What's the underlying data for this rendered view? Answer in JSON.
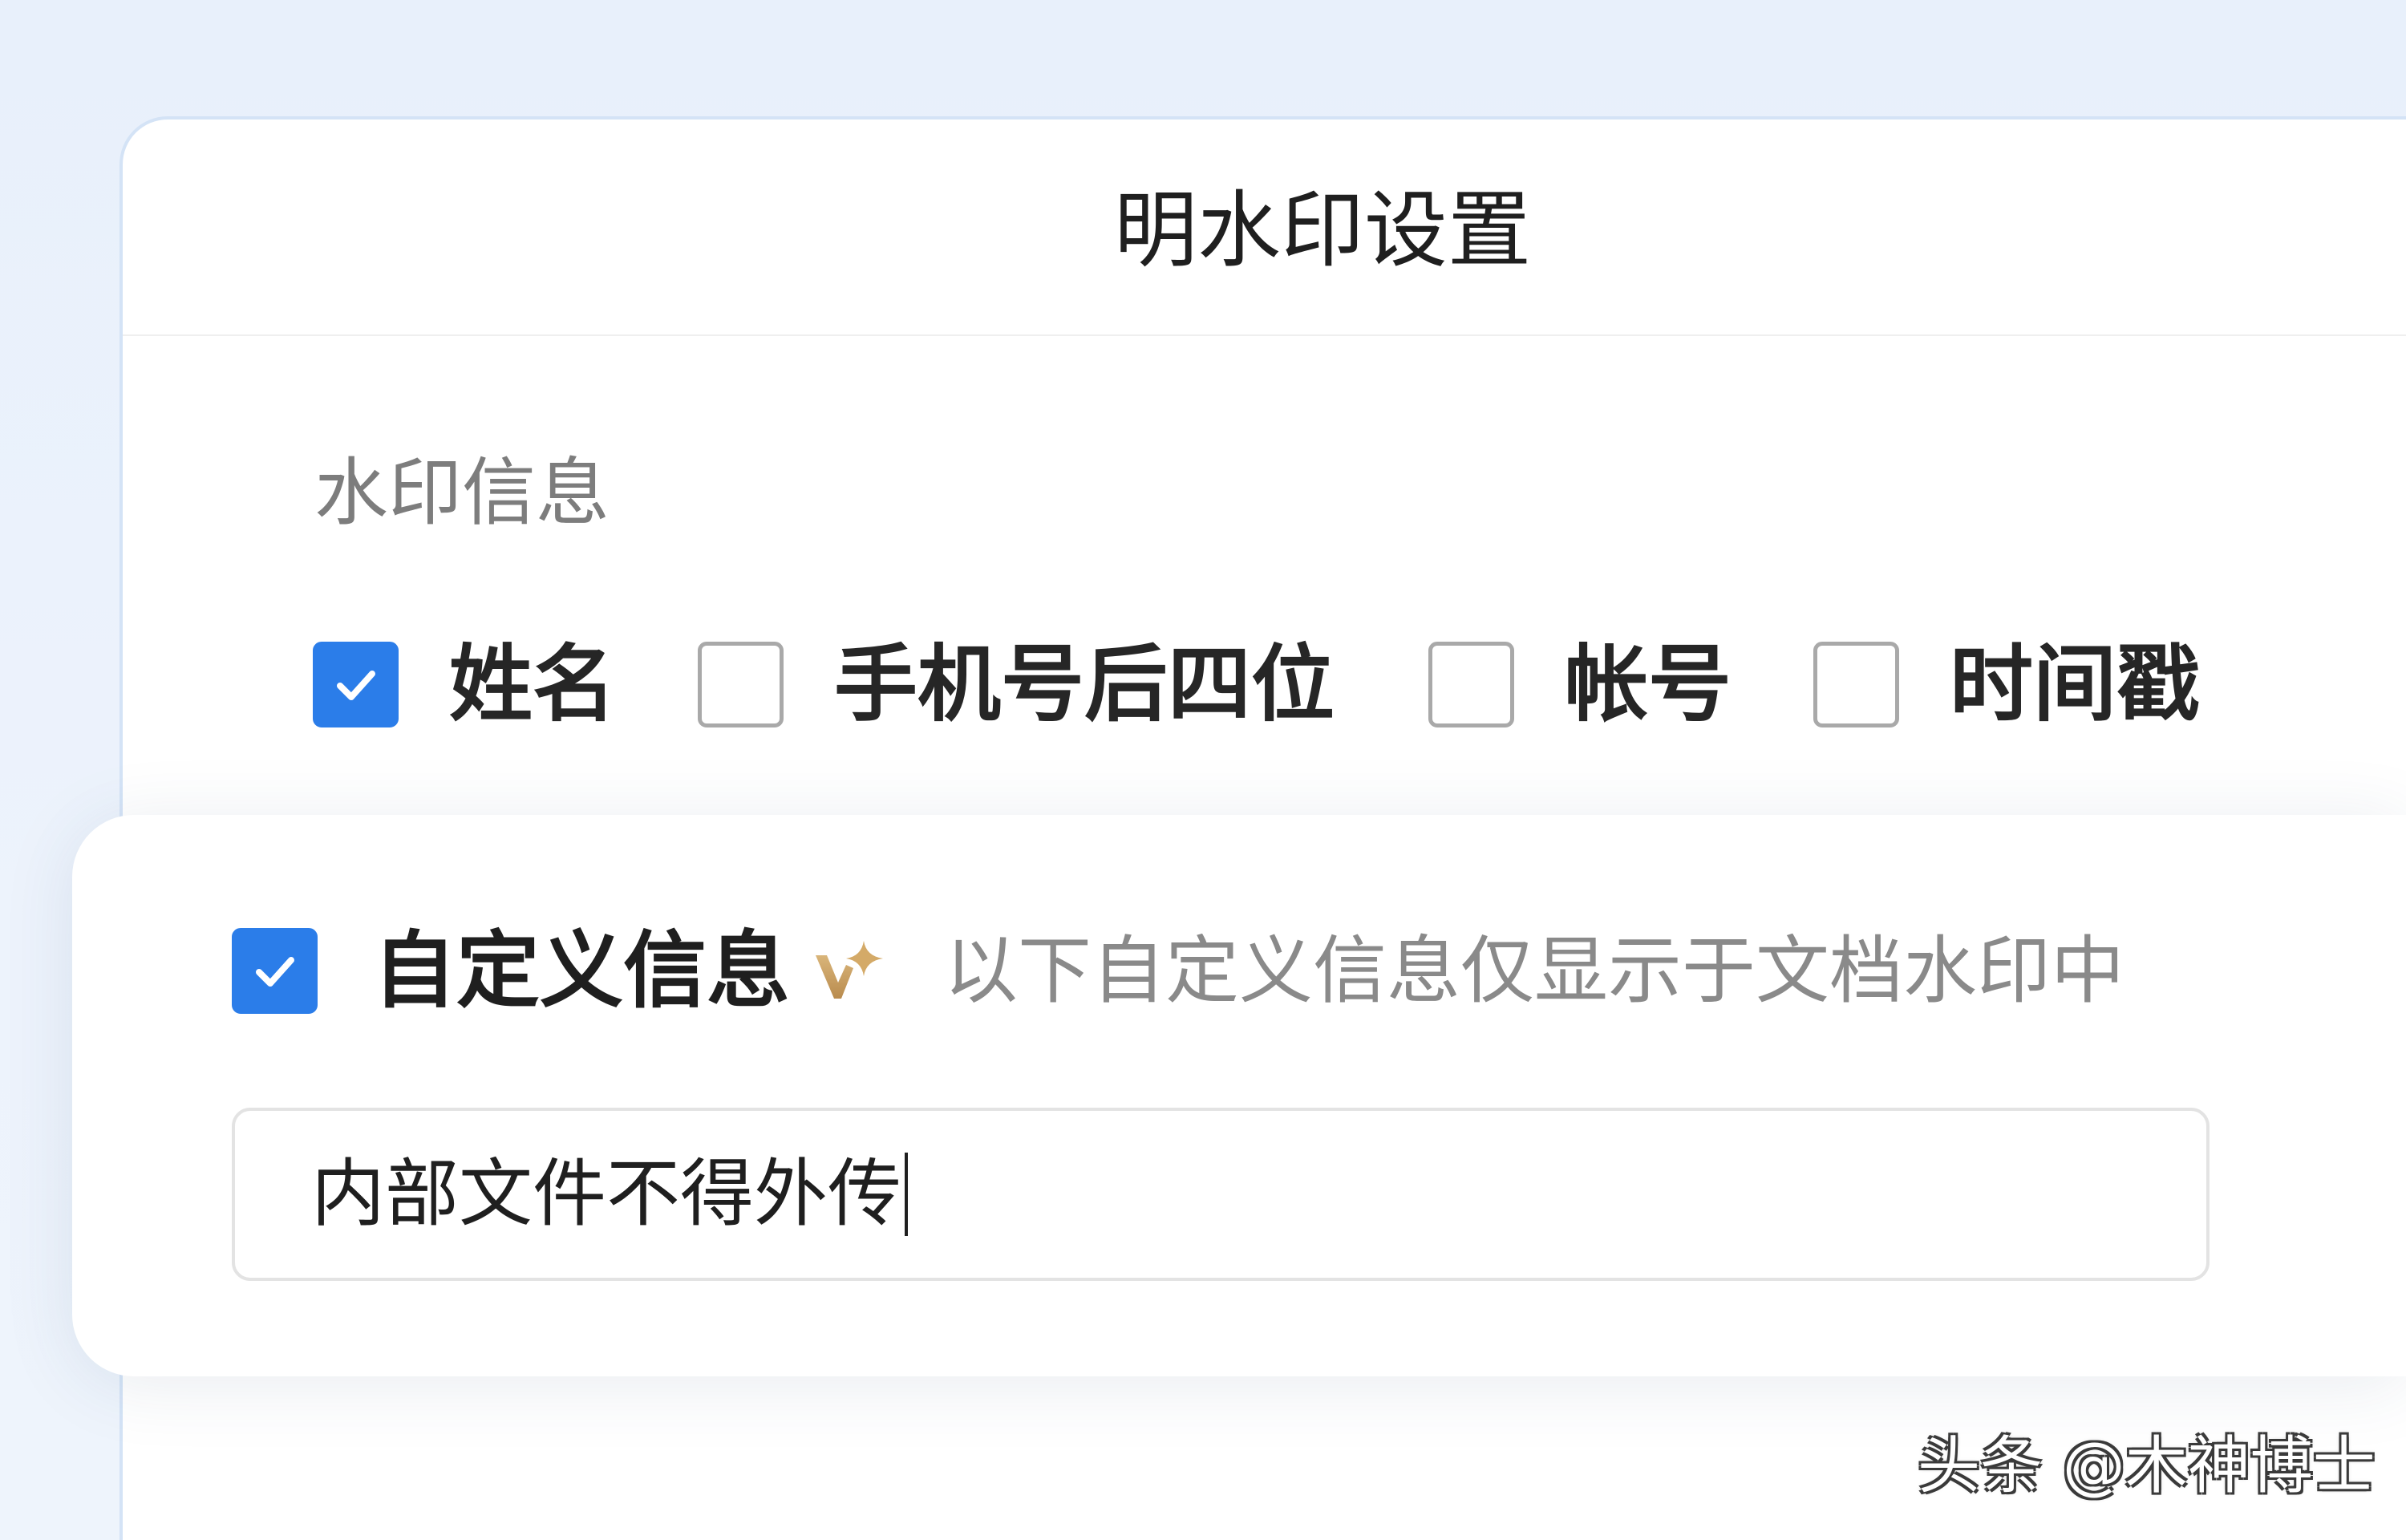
{
  "panel": {
    "title": "明水印设置"
  },
  "watermark_info": {
    "label": "水印信息",
    "options": [
      {
        "label": "姓名",
        "checked": true
      },
      {
        "label": "手机号后四位",
        "checked": false
      },
      {
        "label": "帐号",
        "checked": false
      },
      {
        "label": "时间戳",
        "checked": false
      }
    ]
  },
  "custom_info": {
    "label": "自定义信息",
    "checked": true,
    "badge_icon": "vip-sparkle-icon",
    "hint": "以下自定义信息仅显示于文档水印中",
    "input_value": "内部文件不得外传"
  },
  "overlay_watermark": "头条 @木神博士",
  "icons": {
    "checkbox_mark": "checkmark-icon",
    "custom_badge": "vip-sparkle-icon"
  },
  "colors": {
    "accent": "#2b7de9",
    "badge_gold": "#c9a063",
    "panel_border": "#d4e3f6",
    "hint_text": "#8a8a8a",
    "background": "#e8f0fb"
  }
}
